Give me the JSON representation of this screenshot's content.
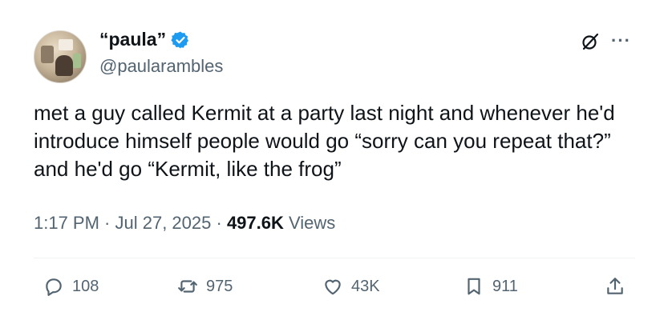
{
  "author": {
    "display_name": "“paula”",
    "handle": "@paularambles",
    "verified_color": "#1d9bf0"
  },
  "tweet": {
    "text": "met a guy called Kermit at a party last night and whenever he'd introduce himself people would go “sorry can you repeat that?” and he'd go “Kermit, like the frog”"
  },
  "meta": {
    "time": "1:17 PM",
    "separator1": " · ",
    "date": "Jul 27, 2025",
    "separator2": " · ",
    "views_count": "497.6K",
    "views_label": " Views"
  },
  "actions": {
    "replies": "108",
    "reposts": "975",
    "likes": "43K",
    "bookmarks": "911"
  },
  "icons": [
    "avatar",
    "verified-badge-icon",
    "grok-icon",
    "more-icon",
    "reply-icon",
    "repost-icon",
    "like-icon",
    "bookmark-icon",
    "share-icon"
  ]
}
